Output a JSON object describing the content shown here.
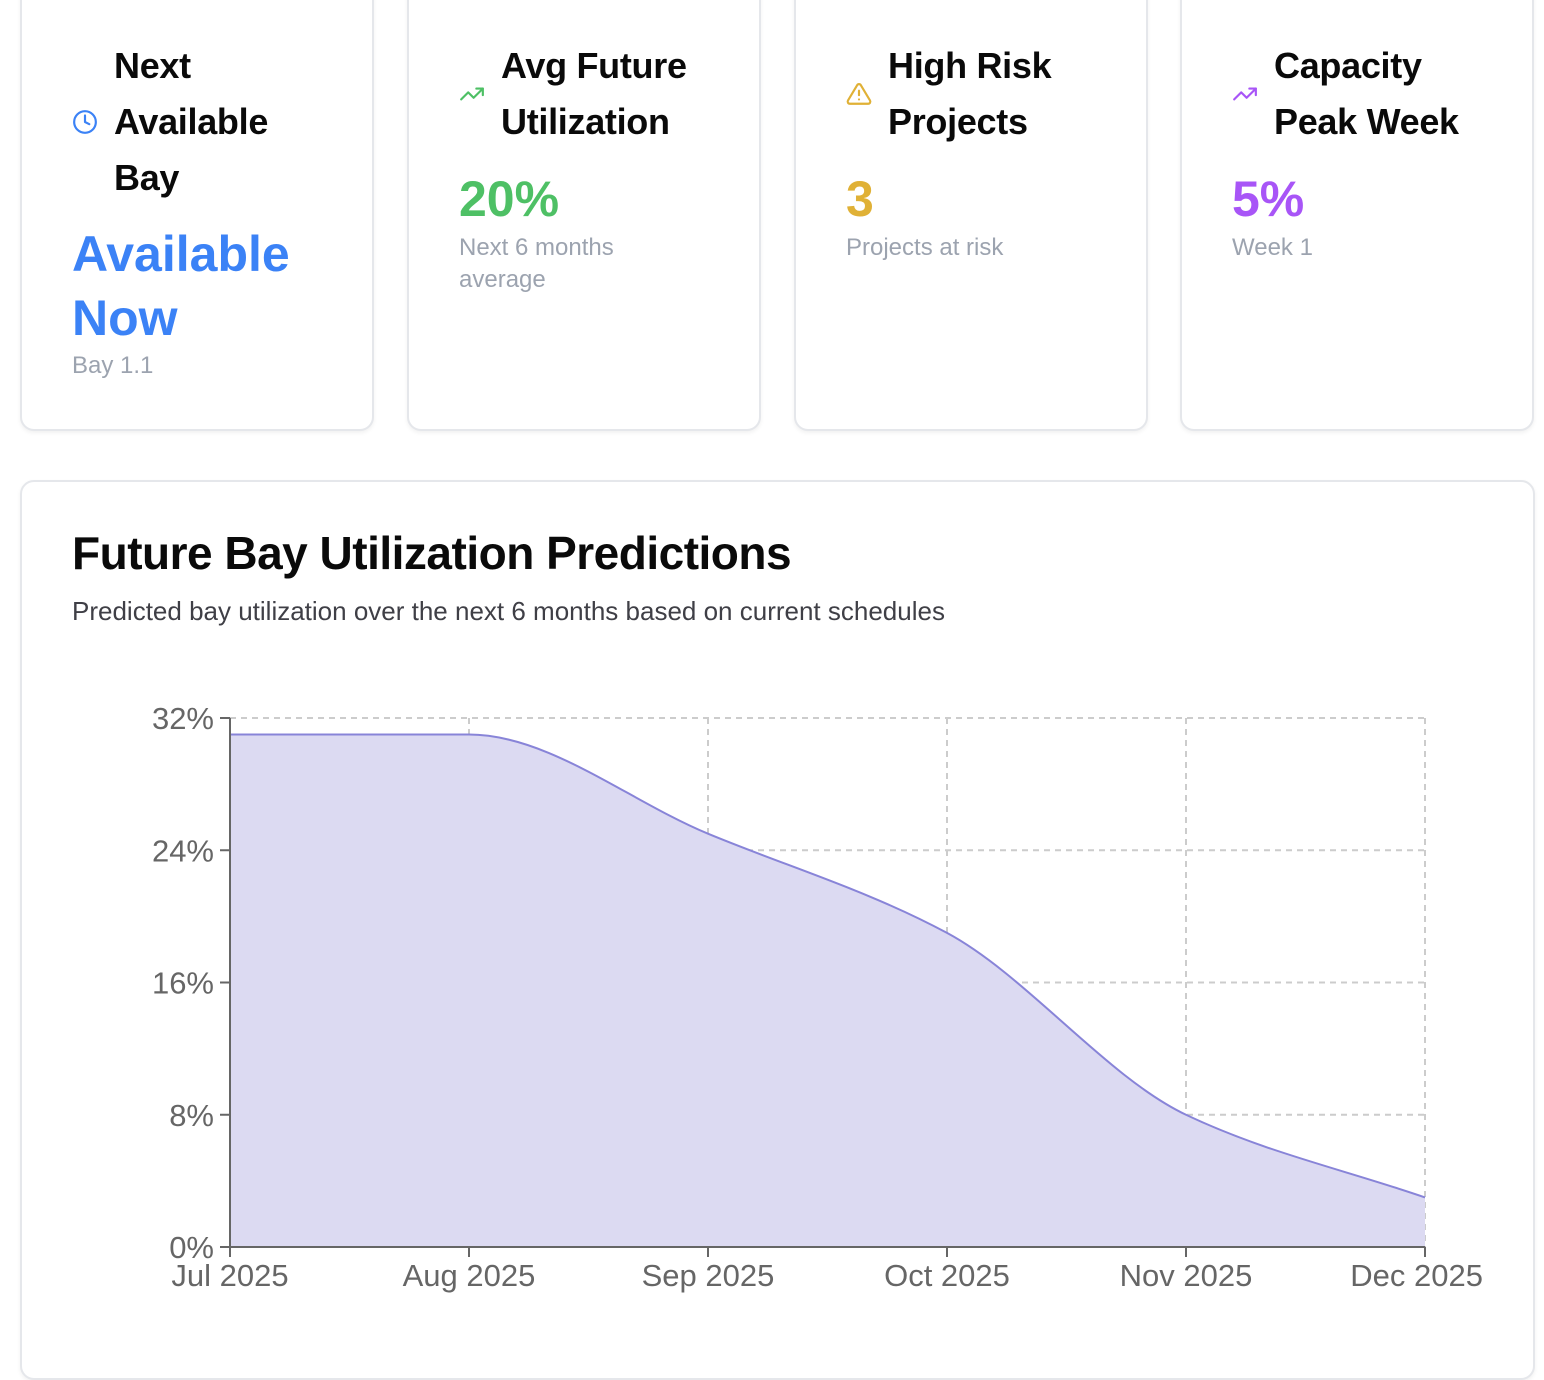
{
  "stats": [
    {
      "icon": "clock-icon",
      "color": "#3b82f6",
      "title": "Next Available Bay",
      "value": "Available Now",
      "sub": "Bay 1.1"
    },
    {
      "icon": "trending-up-icon",
      "color": "#4ec065",
      "title": "Avg Future Utilization",
      "value": "20%",
      "sub": "Next 6 months average"
    },
    {
      "icon": "alert-triangle-icon",
      "color": "#e0b136",
      "title": "High Risk Projects",
      "value": "3",
      "sub": "Projects at risk"
    },
    {
      "icon": "trending-up-icon",
      "color": "#a855f7",
      "title": "Capacity Peak Week",
      "value": "5%",
      "sub": "Week 1"
    }
  ],
  "chart_card": {
    "title": "Future Bay Utilization Predictions",
    "subtitle": "Predicted bay utilization over the next 6 months based on current schedules"
  },
  "chart_data": {
    "type": "area",
    "title": "Future Bay Utilization Predictions",
    "x": [
      "Jul 2025",
      "Aug 2025",
      "Sep 2025",
      "Oct 2025",
      "Nov 2025",
      "Dec 2025"
    ],
    "series": [
      {
        "values": [
          31,
          31,
          25,
          19,
          8,
          3
        ],
        "color": "#8884d8"
      }
    ],
    "ylim": [
      0,
      32
    ],
    "yticks": [
      0,
      8,
      16,
      24,
      32
    ],
    "ytick_labels": [
      "0%",
      "8%",
      "16%",
      "24%",
      "32%"
    ],
    "grid": true,
    "fill_color": "#dcdaf2",
    "line_color": "#8884d8"
  }
}
